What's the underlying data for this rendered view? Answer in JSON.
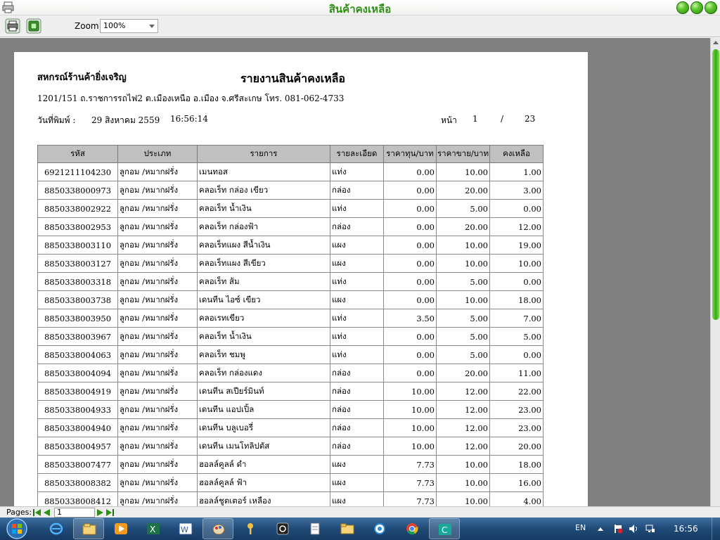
{
  "window": {
    "title": "สินค้าคงเหลือ"
  },
  "toolbar": {
    "zoom_label": "Zoom",
    "zoom_value": "100%"
  },
  "report": {
    "company": "สหกรณ์ร้านค้ายิ่งเจริญ",
    "title": "รายงานสินค้าคงเหลือ",
    "address": "1201/151 ถ.ราชการรถไฟ2 ต.เมืองเหนือ อ.เมือง จ.ศรีสะเกษ  โทร. 081-062-4733",
    "print_label": "วันที่พิมพ์ :",
    "print_date": "29 สิงหาคม 2559",
    "print_time": "16:56:14",
    "page_label": "หน้า",
    "page_number": "1",
    "page_separator": "/",
    "page_total": "23",
    "columns": [
      "รหัส",
      "ประเภท",
      "รายการ",
      "รายละเอียด",
      "ราคาทุน/บาท",
      "ราคาขาย/บาท",
      "คงเหลือ"
    ],
    "rows": [
      [
        "6921211104230",
        "ลูกอม /หมากฝรั่ง",
        "เมนทอส",
        "แท่ง",
        "0.00",
        "10.00",
        "1.00"
      ],
      [
        "8850338000973",
        "ลูกอม /หมากฝรั่ง",
        "คลอเร็ท กล่อง เขียว",
        "กล่อง",
        "0.00",
        "20.00",
        "3.00"
      ],
      [
        "8850338002922",
        "ลูกอม /หมากฝรั่ง",
        "คลอเร็ท น้ำเงิน",
        "แท่ง",
        "0.00",
        "5.00",
        "0.00"
      ],
      [
        "8850338002953",
        "ลูกอม /หมากฝรั่ง",
        "คลอเร็ท กล่องฟ้า",
        "กล่อง",
        "0.00",
        "20.00",
        "12.00"
      ],
      [
        "8850338003110",
        "ลูกอม /หมากฝรั่ง",
        "คลอเร็ทแผง สีน้ำเงิน",
        "แผง",
        "0.00",
        "10.00",
        "19.00"
      ],
      [
        "8850338003127",
        "ลูกอม /หมากฝรั่ง",
        "คลอเร็ทแผง สีเขียว",
        "แผง",
        "0.00",
        "10.00",
        "10.00"
      ],
      [
        "8850338003318",
        "ลูกอม /หมากฝรั่ง",
        "คลอเร็ท ส้ม",
        "แท่ง",
        "0.00",
        "5.00",
        "0.00"
      ],
      [
        "8850338003738",
        "ลูกอม /หมากฝรั่ง",
        "เดนทีน ไอซ์ เขียว",
        "แผง",
        "0.00",
        "10.00",
        "18.00"
      ],
      [
        "8850338003950",
        "ลูกอม /หมากฝรั่ง",
        "คลอเรทเขียว",
        "แท่ง",
        "3.50",
        "5.00",
        "7.00"
      ],
      [
        "8850338003967",
        "ลูกอม /หมากฝรั่ง",
        "คลอเร็ท น้ำเงิน",
        "แท่ง",
        "0.00",
        "5.00",
        "5.00"
      ],
      [
        "8850338004063",
        "ลูกอม /หมากฝรั่ง",
        "คลอเร็ท ชมพู",
        "แท่ง",
        "0.00",
        "5.00",
        "0.00"
      ],
      [
        "8850338004094",
        "ลูกอม /หมากฝรั่ง",
        "คลอเร็ท กล่องแดง",
        "กล่อง",
        "0.00",
        "20.00",
        "11.00"
      ],
      [
        "8850338004919",
        "ลูกอม /หมากฝรั่ง",
        "เดนทีน สเปียร์มินท์",
        "กล่อง",
        "10.00",
        "12.00",
        "22.00"
      ],
      [
        "8850338004933",
        "ลูกอม /หมากฝรั่ง",
        "เดนทีน แอปเปิ้ล",
        "กล่อง",
        "10.00",
        "12.00",
        "23.00"
      ],
      [
        "8850338004940",
        "ลูกอม /หมากฝรั่ง",
        "เดนทีน บลูเบอรี่",
        "กล่อง",
        "10.00",
        "12.00",
        "23.00"
      ],
      [
        "8850338004957",
        "ลูกอม /หมากฝรั่ง",
        "เดนทีน เมนโทลิปตัส",
        "กล่อง",
        "10.00",
        "12.00",
        "20.00"
      ],
      [
        "8850338007477",
        "ลูกอม /หมากฝรั่ง",
        "ฮอลล์คูลล์ ดำ",
        "แผง",
        "7.73",
        "10.00",
        "18.00"
      ],
      [
        "8850338008382",
        "ลูกอม /หมากฝรั่ง",
        "ฮอลล์คูลล์ ฟ้า",
        "แผง",
        "7.73",
        "10.00",
        "16.00"
      ],
      [
        "8850338008412",
        "ลูกอม /หมากฝรั่ง",
        "ฮอลล์ชูตเตอร์ เหลือง",
        "แผง",
        "7.73",
        "10.00",
        "4.00"
      ]
    ]
  },
  "pagebar": {
    "label": "Pages:",
    "current_page": "1"
  },
  "taskbar": {
    "language": "EN",
    "clock": "16:56"
  },
  "colors": {
    "title_green": "#2e8f14",
    "viewer_bg": "#808080",
    "header_gray": "#c0c0c0",
    "taskbar_blue": "#1f4a78"
  }
}
